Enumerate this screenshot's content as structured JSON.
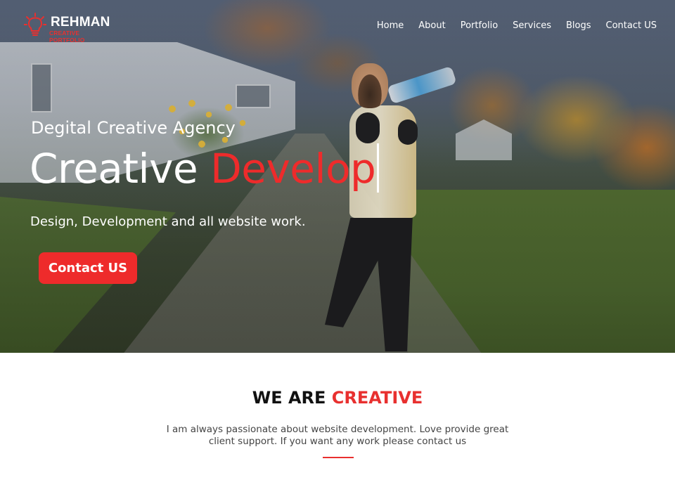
{
  "brand": {
    "name": "REHMAN",
    "tagline": "CREATIVE PORTFOLIO",
    "logo_icon": "lightbulb-icon"
  },
  "nav": {
    "items": [
      {
        "label": "Home"
      },
      {
        "label": "About"
      },
      {
        "label": "Portfolio"
      },
      {
        "label": "Services"
      },
      {
        "label": "Blogs"
      },
      {
        "label": "Contact US"
      }
    ]
  },
  "hero": {
    "kicker": "Degital Creative Agency",
    "title_white": "Creative",
    "title_accent": "Develop",
    "description": "Design, Development and all website work.",
    "cta_label": "Contact US"
  },
  "about": {
    "title_dark": "WE ARE",
    "title_accent": "CREATIVE",
    "text": "I am always passionate about website development. Love provide great client support. If you want any work please contact us"
  },
  "colors": {
    "accent": "#ee2b2b",
    "text_dark": "#111111",
    "text_muted": "#444444"
  }
}
